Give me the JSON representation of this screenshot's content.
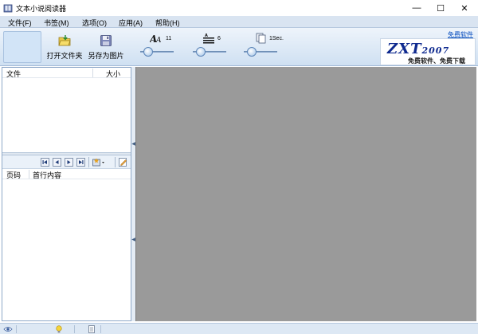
{
  "window": {
    "title": "文本小说阅读器",
    "minimize_glyph": "—",
    "maximize_glyph": "☐",
    "close_glyph": "✕"
  },
  "menu": [
    {
      "label": "文件(F)"
    },
    {
      "label": "书签(M)"
    },
    {
      "label": "选项(O)"
    },
    {
      "label": "应用(A)"
    },
    {
      "label": "帮助(H)"
    }
  ],
  "toolbar": {
    "open_folder_label": "打开文件夹",
    "save_image_label": "另存为图片",
    "font_size_value": "11",
    "line_spacing_value": "6",
    "page_interval_value": "1Sec.",
    "free_software_link": "免费软件",
    "logo_text": "ZXT",
    "logo_year": "2007",
    "logo_slogan": "免费软件、免费下载",
    "font_size_level": 0.12,
    "line_spacing_level": 0.12,
    "page_interval_level": 0.12
  },
  "files_panel": {
    "col_file": "文件",
    "col_size": "大小"
  },
  "bookmarks_panel": {
    "col_page": "页码",
    "col_first_line": "首行内容"
  },
  "icons": {
    "app": "book-icon",
    "open_folder": "folder-open-icon",
    "save_image": "floppy-disk-icon",
    "font_size": "font-size-icon",
    "line_spacing": "line-spacing-icon",
    "page_interval": "page-interval-icon",
    "first": "first-page-icon",
    "prev": "prev-page-icon",
    "next": "next-page-icon",
    "last": "last-page-icon",
    "add_bookmark": "add-bookmark-icon",
    "edit": "edit-icon",
    "status_eye": "eye-icon",
    "status_bulb": "lightbulb-icon",
    "status_doc": "document-icon"
  },
  "colors": {
    "menubar": "#d9e4f1",
    "reader_background": "#9a9a9a",
    "link": "#0a4fbf",
    "logo": "#0f2a8f"
  }
}
